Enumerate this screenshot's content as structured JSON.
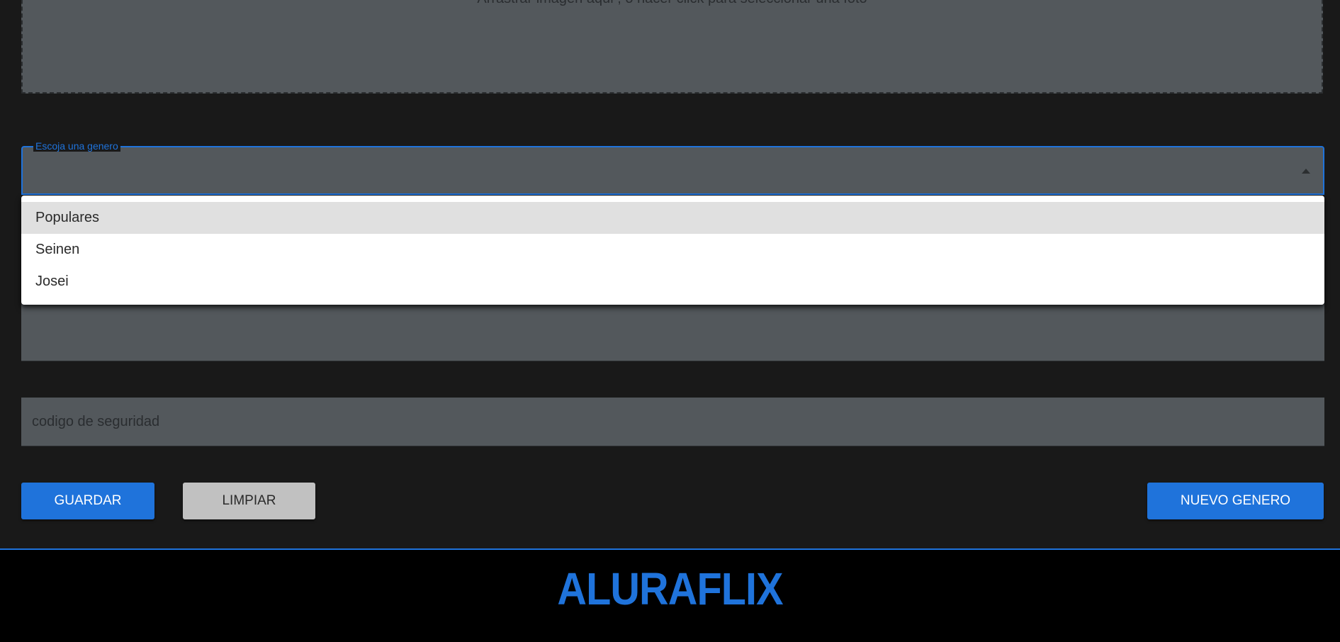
{
  "upload": {
    "hint": "Arrastrar imagen aqui , o hacer click para seleccionar una foto"
  },
  "genre_select": {
    "label": "Escoja una genero",
    "value": "",
    "options": [
      {
        "label": "Populares"
      },
      {
        "label": "Seinen"
      },
      {
        "label": "Josei"
      }
    ]
  },
  "security_field": {
    "placeholder": "codigo de seguridad"
  },
  "buttons": {
    "save": "GUARDAR",
    "clear": "LIMPIAR",
    "new_genre": "NUEVO GENERO"
  },
  "footer": {
    "logo": "ALURAFLIX"
  },
  "colors": {
    "accent": "#1f73db",
    "background": "#191919",
    "field": "#53585c",
    "footer": "#000000"
  }
}
